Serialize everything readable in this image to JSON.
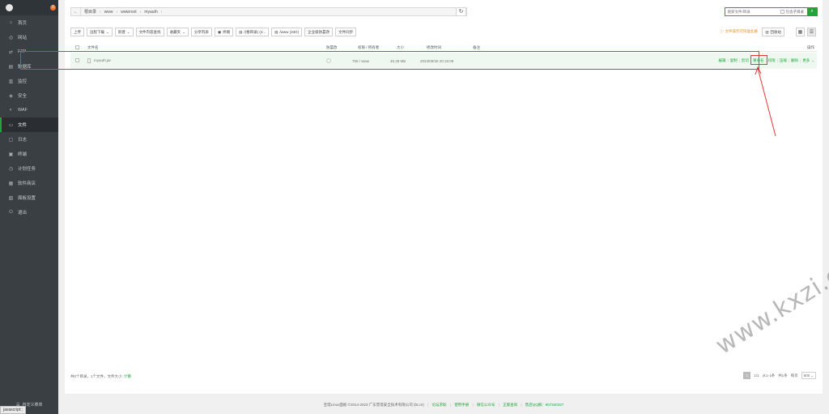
{
  "sidebar": {
    "badge": "0",
    "items": [
      {
        "label": "首页",
        "icon": "home-icon",
        "glyph": "⌂"
      },
      {
        "label": "网站",
        "icon": "globe-icon",
        "glyph": "◎"
      },
      {
        "label": "FTP",
        "icon": "ftp-icon",
        "glyph": "⇄"
      },
      {
        "label": "数据库",
        "icon": "database-icon",
        "glyph": "▤"
      },
      {
        "label": "监控",
        "icon": "monitor-icon",
        "glyph": "▥"
      },
      {
        "label": "安全",
        "icon": "shield-icon",
        "glyph": "◈"
      },
      {
        "label": "WAF",
        "icon": "waf-icon",
        "glyph": "◐"
      },
      {
        "label": "文件",
        "icon": "folder-icon",
        "glyph": "▭"
      },
      {
        "label": "日志",
        "icon": "log-icon",
        "glyph": "▢"
      },
      {
        "label": "终端",
        "icon": "terminal-icon",
        "glyph": "▣"
      },
      {
        "label": "计划任务",
        "icon": "clock-icon",
        "glyph": "◷"
      },
      {
        "label": "软件商店",
        "icon": "store-icon",
        "glyph": "▦"
      },
      {
        "label": "面板设置",
        "icon": "settings-icon",
        "glyph": "▧"
      },
      {
        "label": "退出",
        "icon": "logout-icon",
        "glyph": "⏻"
      }
    ],
    "active_label": "文件",
    "bottom_label": "自定义菜单",
    "js_status": "javascript:;"
  },
  "path": {
    "crumbs": [
      "根目录",
      "www",
      "wwwroot",
      "myauth"
    ]
  },
  "search": {
    "placeholder": "搜索文件/目录",
    "subdir_label": "包含子目录"
  },
  "toolbar": {
    "buttons": [
      {
        "label": "上传",
        "caret": false,
        "icon": ""
      },
      {
        "label": "远程下载",
        "caret": true,
        "icon": ""
      },
      {
        "label": "新建",
        "caret": true,
        "icon": ""
      },
      {
        "label": "文件内容查找",
        "caret": false,
        "icon": ""
      },
      {
        "label": "收藏夹",
        "caret": true,
        "icon": ""
      },
      {
        "label": "分享列表",
        "caret": false,
        "icon": ""
      },
      {
        "label": "终端",
        "caret": false,
        "icon": "▣"
      },
      {
        "label": "/(根目录) (4...",
        "caret": false,
        "icon": "▤"
      },
      {
        "label": "/www (33G)",
        "caret": false,
        "icon": "▤"
      },
      {
        "label": "企业级防篡改",
        "caret": false,
        "icon": ""
      },
      {
        "label": "文件同步",
        "caret": false,
        "icon": ""
      }
    ],
    "recycle_tip": "文件操作可恢复此删",
    "recycle_label": "回收站"
  },
  "table": {
    "headers": {
      "name": "文件名",
      "protect": "防篡改",
      "perm": "权限 / 所有者",
      "size": "大小",
      "mtime": "修改时间",
      "remark": "备注",
      "ops": "操作"
    },
    "rows": [
      {
        "name": "myauth.jar",
        "perm": "755 / www",
        "size": "45.28 MB",
        "mtime": "2023/08/30 20:15:08",
        "remark": "",
        "ops": [
          "编辑",
          "复制",
          "剪切",
          "重命名",
          "权限",
          "压缩",
          "删除",
          "更多"
        ]
      }
    ]
  },
  "footer": {
    "summary": "共0个目录，1个文件，文件大小:",
    "calc_label": "计算",
    "pager": {
      "current": "1",
      "page_info": "1/1",
      "first": "从1-1条",
      "total": "共1条",
      "per_page_label": "每页",
      "per_page": "500"
    }
  },
  "copyright": {
    "text": "宝塔Linux面板 ©2014-2023 广东堡塔安全技术有限公司 (bt.cn)",
    "links": [
      "论坛求助",
      "使用手册",
      "微信公众号",
      "正版查询"
    ],
    "qq": "售后QQ群：907340327"
  },
  "watermark": "www.kxzi.cn",
  "colors": {
    "accent": "#20a53a",
    "highlight": "#e53935",
    "sidebar_bg": "#3a3f44",
    "warn": "#e6931e"
  }
}
